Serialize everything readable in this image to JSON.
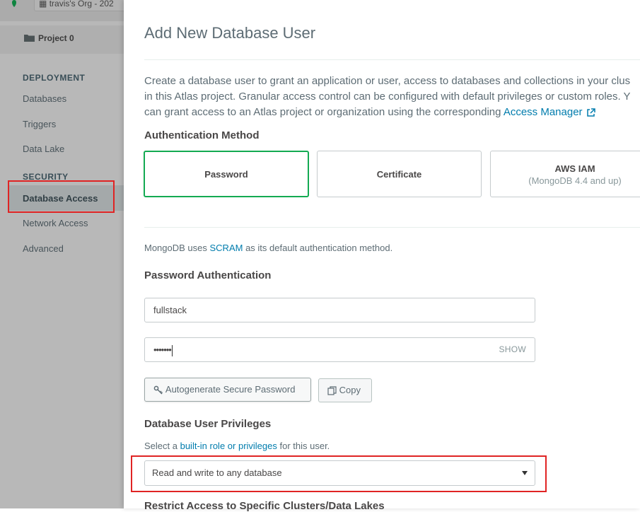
{
  "sidebar": {
    "org_label": "travis's Org - 202",
    "project_label": "Project 0",
    "deployment_heading": "DEPLOYMENT",
    "deployment_items": [
      "Databases",
      "Triggers",
      "Data Lake"
    ],
    "security_heading": "SECURITY",
    "security_items": [
      "Database Access",
      "Network Access",
      "Advanced"
    ]
  },
  "modal": {
    "title": "Add New Database User",
    "description_line1": "Create a database user to grant an application or user, access to databases and collections in your clus",
    "description_line2": "in this Atlas project. Granular access control can be configured with default privileges or custom roles. Y",
    "description_line3_prefix": "can grant access to an Atlas project or organization using the corresponding ",
    "description_link": "Access Manager",
    "auth_method_heading": "Authentication Method",
    "auth_methods": [
      {
        "label": "Password",
        "sub": ""
      },
      {
        "label": "Certificate",
        "sub": ""
      },
      {
        "label": "AWS IAM",
        "sub": "(MongoDB 4.4 and up)"
      }
    ],
    "scram_prefix": "MongoDB uses ",
    "scram_link": "SCRAM",
    "scram_suffix": " as its default authentication method.",
    "password_auth_heading": "Password Authentication",
    "username_value": "fullstack",
    "password_mask": "•••••••",
    "show_label": "SHOW",
    "autogenerate_label": "Autogenerate Secure Password",
    "copy_label": "Copy",
    "privileges_heading": "Database User Privileges",
    "privileges_prefix": "Select a ",
    "privileges_link": "built-in role or privileges",
    "privileges_suffix": " for this user.",
    "role_selected": "Read and write to any database",
    "restrict_heading": "Restrict Access to Specific Clusters/Data Lakes"
  },
  "colors": {
    "accent_green": "#13aa52",
    "link_blue": "#007cad",
    "highlight_red": "#e02424"
  }
}
